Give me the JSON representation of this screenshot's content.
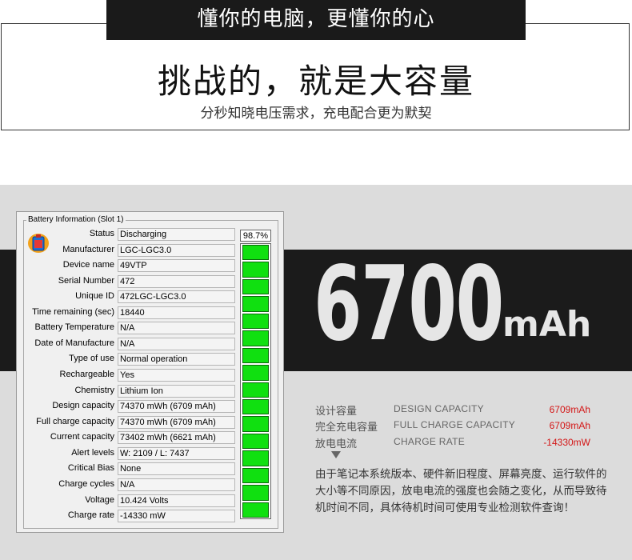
{
  "header": {
    "top_bar": "懂你的电脑，更懂你的心",
    "headline": "挑战的，就是大容量",
    "subline": "分秒知晓电压需求，充电配合更为默契"
  },
  "capacity": {
    "number": "6700",
    "unit": "mAh"
  },
  "battery_window": {
    "group_title": "Battery Information (Slot 1)",
    "percent": "98.7%",
    "charge_fraction": 0.987,
    "colors": {
      "meter_on": "#10e010",
      "meter_top": "#000000"
    },
    "rows": [
      {
        "label": "Status",
        "value": "Discharging"
      },
      {
        "label": "Manufacturer",
        "value": "LGC-LGC3.0"
      },
      {
        "label": "Device name",
        "value": "49VTP"
      },
      {
        "label": "Serial Number",
        "value": " 472"
      },
      {
        "label": "Unique ID",
        "value": " 472LGC-LGC3.0"
      },
      {
        "label": "Time remaining (sec)",
        "value": "18440"
      },
      {
        "label": "Battery Temperature",
        "value": "N/A"
      },
      {
        "label": "Date of Manufacture",
        "value": "N/A"
      },
      {
        "label": "Type of use",
        "value": "Normal operation"
      },
      {
        "label": "Rechargeable",
        "value": "Yes"
      },
      {
        "label": "Chemistry",
        "value": "Lithium Ion"
      },
      {
        "label": "Design capacity",
        "value": "74370 mWh (6709 mAh)"
      },
      {
        "label": "Full charge capacity",
        "value": "74370 mWh (6709 mAh)"
      },
      {
        "label": "Current capacity",
        "value": "73402 mWh (6621 mAh)"
      },
      {
        "label": "Alert levels",
        "value": "W: 2109 / L: 7437"
      },
      {
        "label": "Critical Bias",
        "value": "None"
      },
      {
        "label": "Charge cycles",
        "value": "N/A"
      },
      {
        "label": "Voltage",
        "value": "10.424 Volts"
      },
      {
        "label": "Charge rate",
        "value": "-14330 mW"
      }
    ]
  },
  "specs": [
    {
      "cn": "设计容量",
      "en": "DESIGN CAPACITY",
      "value": "6709mAh"
    },
    {
      "cn": "完全充电容量",
      "en": "FULL CHARGE CAPACITY",
      "value": "6709mAh"
    },
    {
      "cn": "放电电流",
      "en": "CHARGE RATE",
      "value": "-14330mW"
    }
  ],
  "note": "由于笔记本系统版本、硬件新旧程度、屏幕亮度、运行软件的大小等不同原因，放电电流的强度也会随之变化，从而导致待机时间不同，具体待机时间可使用专业检测软件查询！",
  "icons": {
    "battery": "battery-icon",
    "arrow": "arrow-down-icon"
  }
}
